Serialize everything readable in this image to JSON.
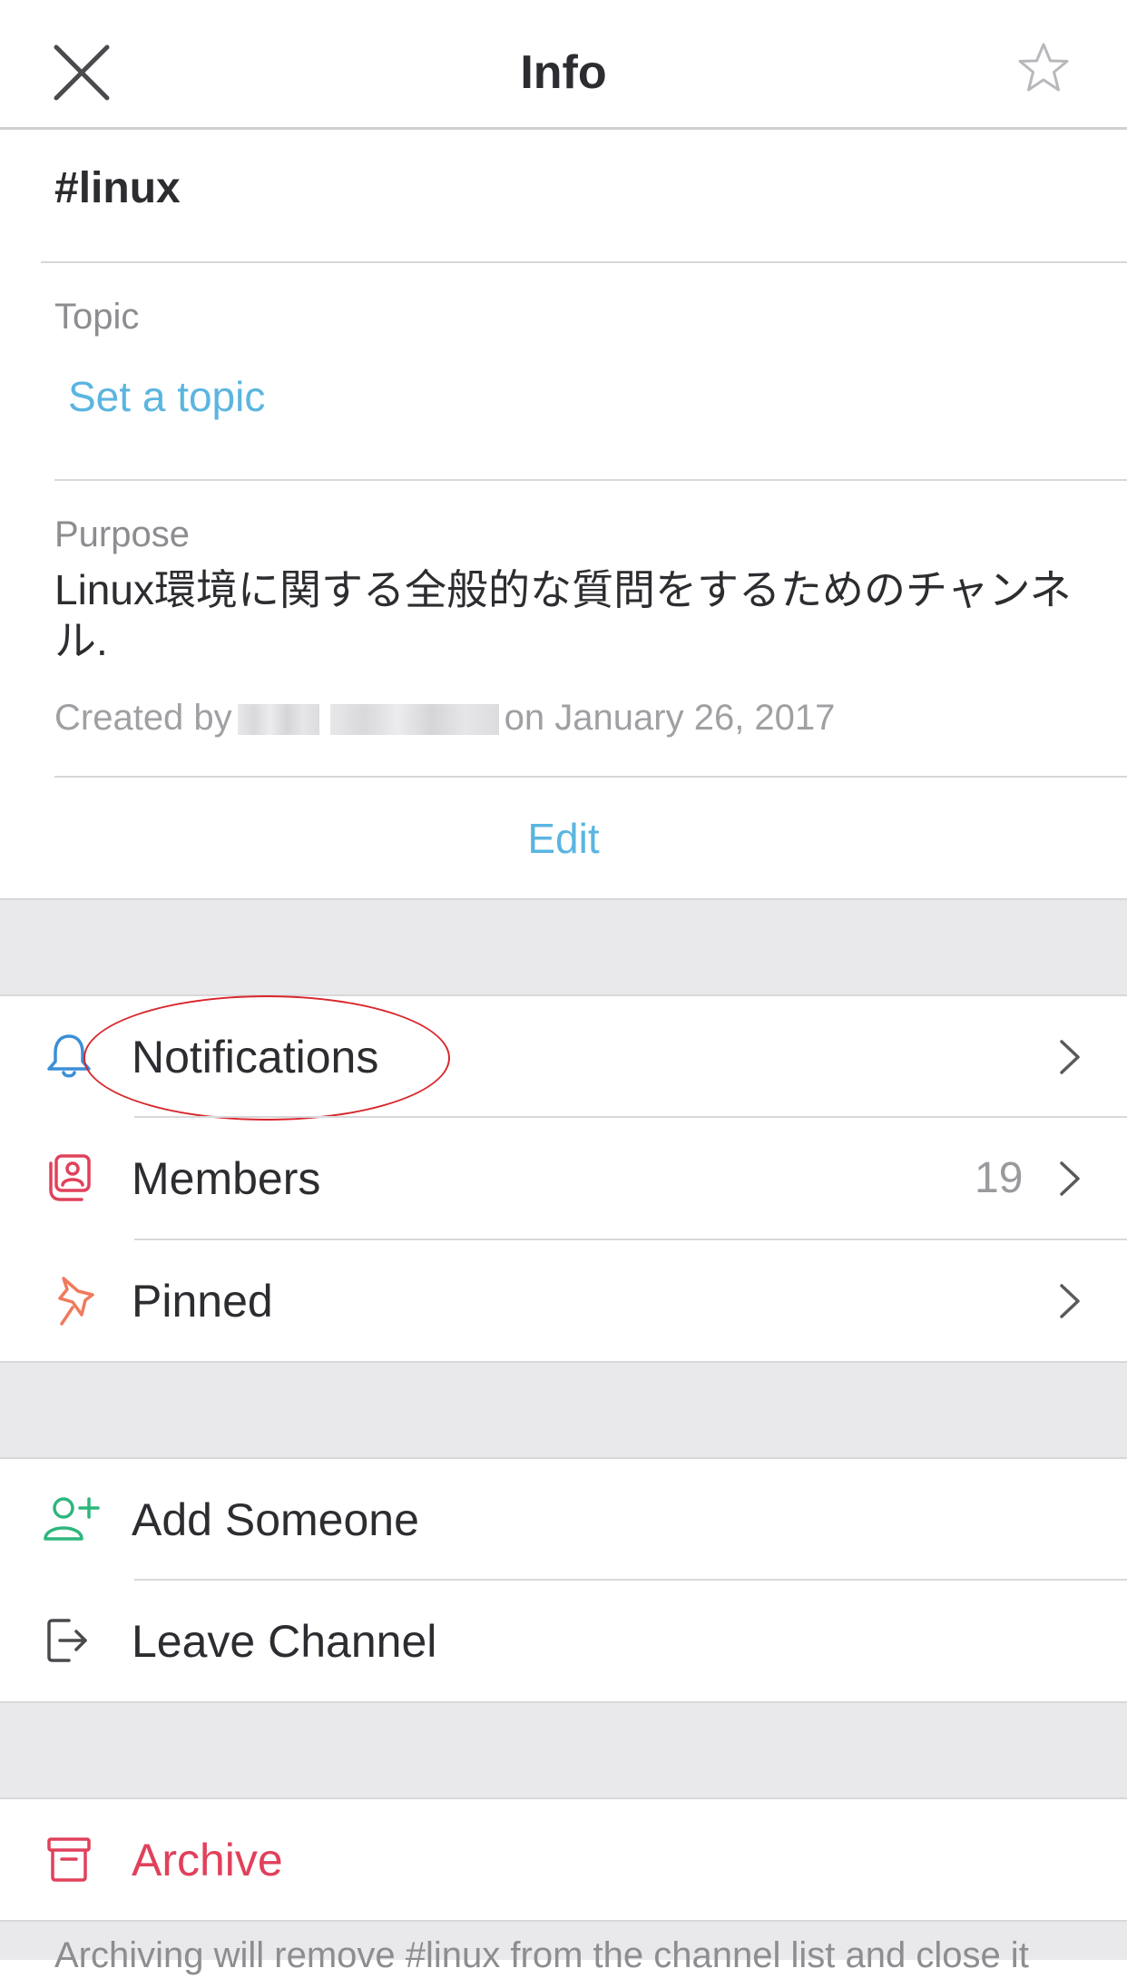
{
  "header": {
    "title": "Info"
  },
  "channel": {
    "name": "#linux"
  },
  "topic": {
    "label": "Topic",
    "set_link": "Set a topic"
  },
  "purpose": {
    "label": "Purpose",
    "text": "Linux環境に関する全般的な質問をするためのチャンネル.",
    "created_prefix": "Created by",
    "created_suffix": "on January 26, 2017"
  },
  "edit": {
    "label": "Edit"
  },
  "menu": {
    "notifications": "Notifications",
    "members": "Members",
    "members_count": "19",
    "pinned": "Pinned",
    "add_someone": "Add Someone",
    "leave_channel": "Leave Channel",
    "archive": "Archive"
  },
  "footer": {
    "note": "Archiving will remove #linux from the channel list and close it"
  },
  "colors": {
    "link": "#5bb5e0",
    "archive": "#e0415b",
    "bell": "#3c8fd6",
    "members": "#e0415b",
    "pin": "#f07a5c",
    "add_person": "#2eb67d",
    "annotation": "#d9262c"
  },
  "icons": {
    "close": "close-icon",
    "star": "star-icon",
    "notifications": "bell-icon",
    "members": "members-icon",
    "pinned": "pin-icon",
    "add_someone": "add-person-icon",
    "leave_channel": "leave-icon",
    "archive": "archive-icon",
    "chevron": "chevron-right-icon"
  }
}
